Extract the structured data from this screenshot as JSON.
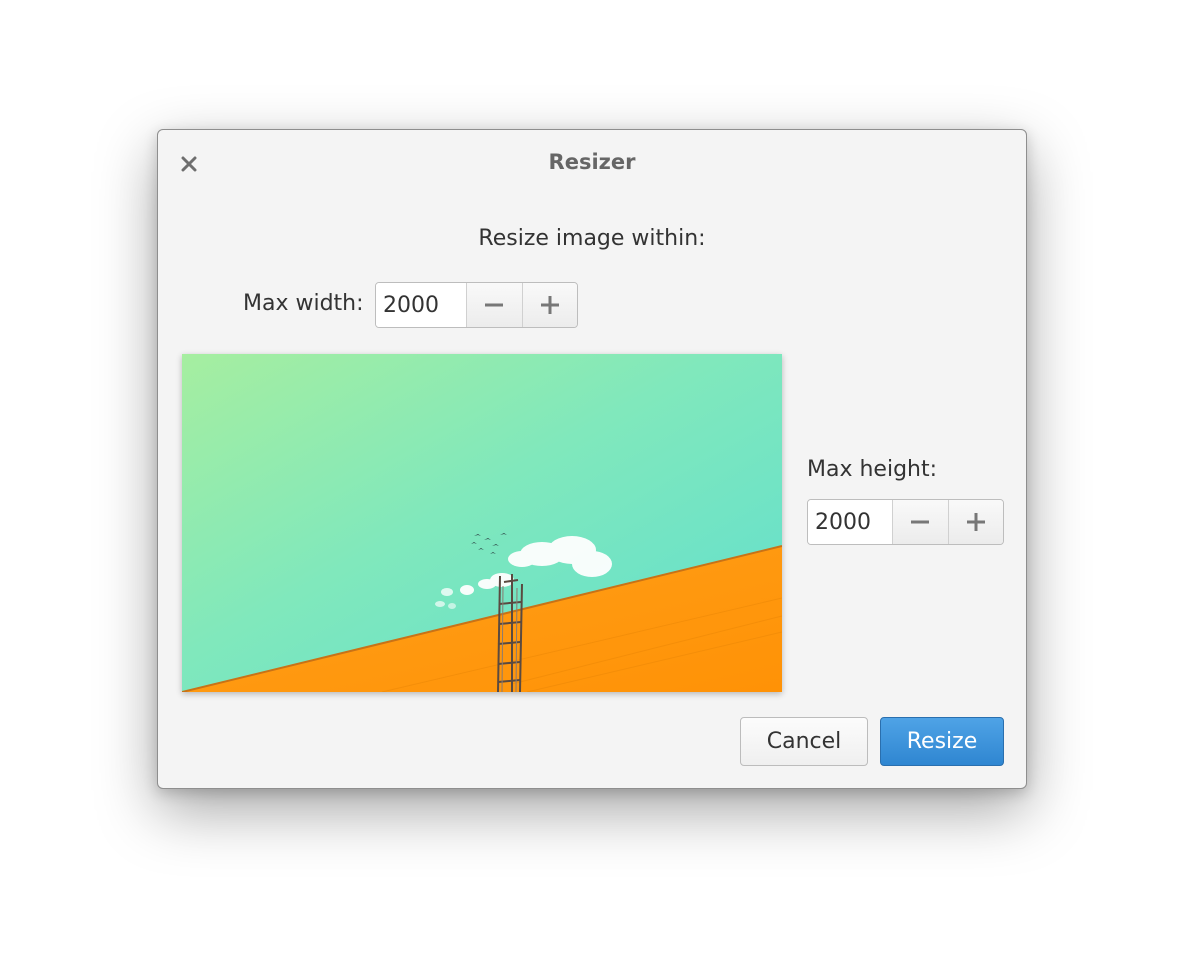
{
  "window": {
    "title": "Resizer"
  },
  "dialog": {
    "subtitle": "Resize image within:",
    "max_width": {
      "label": "Max width:",
      "value": "2000"
    },
    "max_height": {
      "label": "Max height:",
      "value": "2000"
    }
  },
  "buttons": {
    "cancel": "Cancel",
    "resize": "Resize"
  },
  "colors": {
    "accent": "#3b8fd9",
    "sky": "#7ee6c6",
    "wall": "#ff9a0e"
  },
  "icons": {
    "close": "close-icon",
    "decrement": "minus-icon",
    "increment": "plus-icon"
  }
}
